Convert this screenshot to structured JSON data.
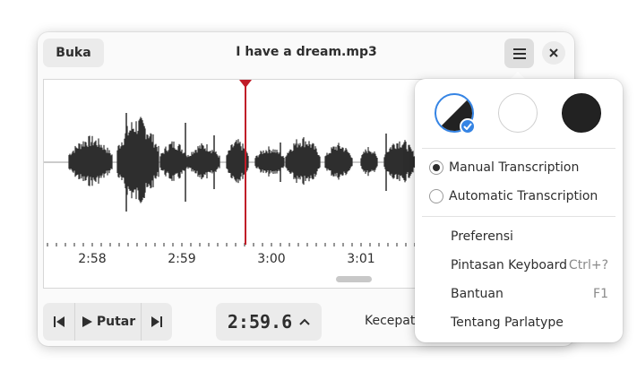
{
  "header": {
    "open_label": "Buka",
    "title": "I have a dream.mp3",
    "menu_icon": "hamburger-menu-icon",
    "close_icon": "close-icon"
  },
  "waveform": {
    "tick_labels": [
      "2:58",
      "2:59",
      "3:00",
      "3:01"
    ],
    "playhead_color": "#c01c28"
  },
  "controls": {
    "play_label": "Putar",
    "timecode": "2:59.6",
    "speed_label": "Kecepatan"
  },
  "menu": {
    "style_swatches": [
      "follow-system",
      "light",
      "dark"
    ],
    "selected_style": "follow-system",
    "radios": [
      {
        "label": "Manual Transcription",
        "checked": true
      },
      {
        "label": "Automatic Transcription",
        "checked": false
      }
    ],
    "items": [
      {
        "label": "Preferensi",
        "accel": ""
      },
      {
        "label": "Pintasan Keyboard",
        "accel": "Ctrl+?"
      },
      {
        "label": "Bantuan",
        "accel": "F1"
      },
      {
        "label": "Tentang Parlatype",
        "accel": ""
      }
    ]
  },
  "colors": {
    "accent": "#3584e4",
    "waveform": "#2e2e2e"
  }
}
